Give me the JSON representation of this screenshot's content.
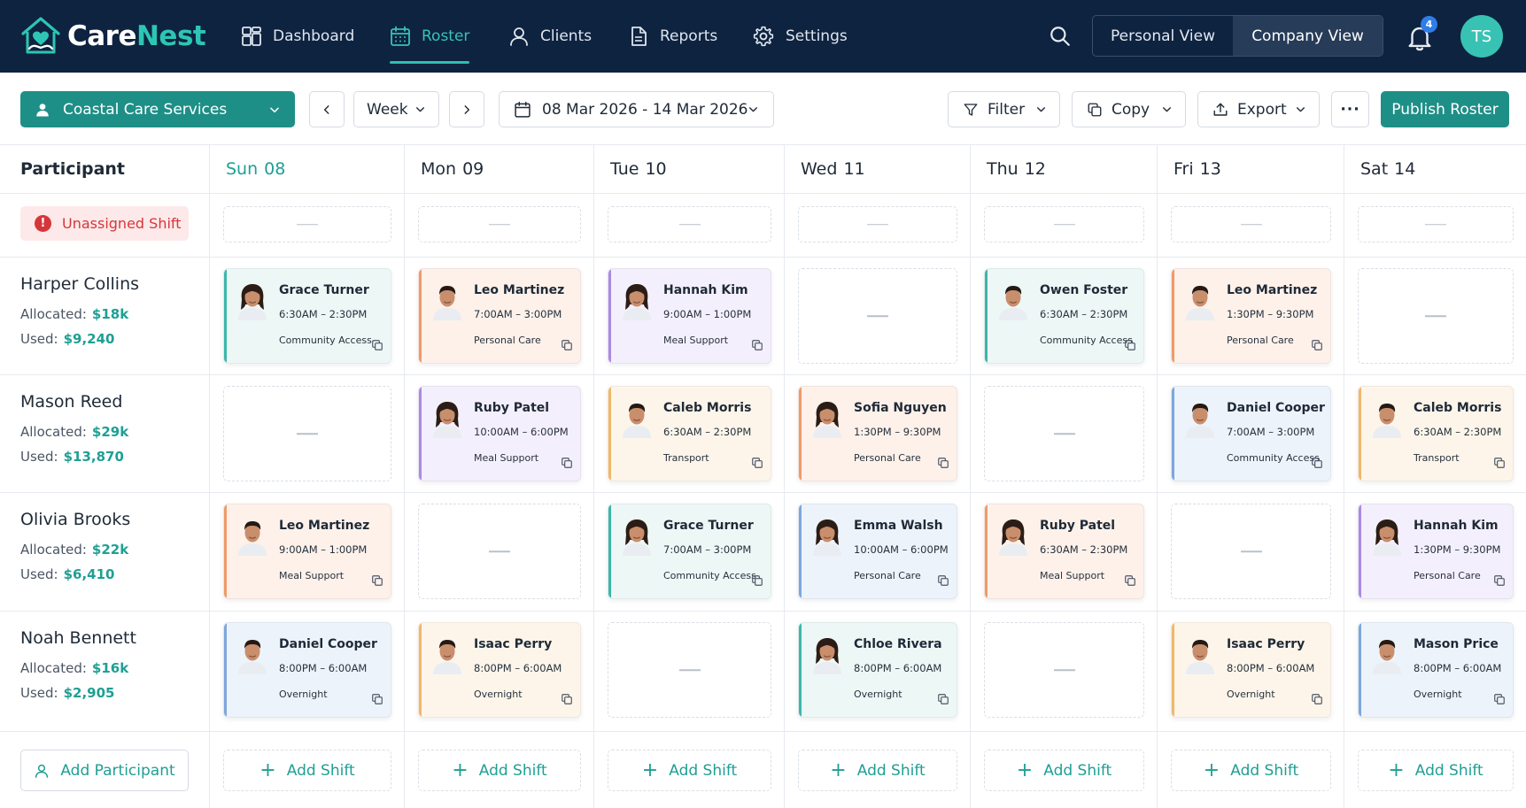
{
  "brand": {
    "name_part1": "Care",
    "name_part2": "Nest",
    "accent": "#2dc5b4",
    "header_bg": "#0e2340"
  },
  "nav": [
    {
      "label": "Dashboard",
      "icon": "dashboard-icon",
      "active": false
    },
    {
      "label": "Roster",
      "icon": "calendar-icon",
      "active": true
    },
    {
      "label": "Clients",
      "icon": "user-icon",
      "active": false
    },
    {
      "label": "Reports",
      "icon": "document-icon",
      "active": false
    },
    {
      "label": "Settings",
      "icon": "gear-icon",
      "active": false
    }
  ],
  "header": {
    "view_personal": "Personal View",
    "view_company": "Company View",
    "selected_view": "Company View",
    "notification_count": "4",
    "avatar_initials": "TS"
  },
  "toolbar": {
    "organization": "Coastal Care Services",
    "range_mode": "Week",
    "date_range": "08 Mar 2026 - 14 Mar 2026",
    "filter": "Filter",
    "copy": "Copy",
    "export": "Export",
    "more": "···",
    "publish": "Publish Roster"
  },
  "grid": {
    "participant_header": "Participant",
    "unassigned_label": "Unassigned Shift",
    "days": [
      {
        "dow": "Sun",
        "date": "08",
        "today": true
      },
      {
        "dow": "Mon",
        "date": "09",
        "today": false
      },
      {
        "dow": "Tue",
        "date": "10",
        "today": false
      },
      {
        "dow": "Wed",
        "date": "11",
        "today": false
      },
      {
        "dow": "Thu",
        "date": "12",
        "today": false
      },
      {
        "dow": "Fri",
        "date": "13",
        "today": false
      },
      {
        "dow": "Sat",
        "date": "14",
        "today": false
      }
    ],
    "allocated_label": "Allocated:",
    "used_label": "Used:",
    "add_participant": "Add Participant",
    "add_shift": "Add Shift",
    "rows": [
      {
        "participant": "Harper Collins",
        "allocated": "$18k",
        "used": "$9,240",
        "shifts": [
          {
            "worker": "Grace Turner",
            "time": "6:30AM – 2:30PM",
            "type": "Community Access",
            "color": "teal",
            "face": "f"
          },
          {
            "worker": "Leo Martinez",
            "time": "7:00AM – 3:00PM",
            "type": "Personal Care",
            "color": "orange",
            "face": "m"
          },
          {
            "worker": "Hannah Kim",
            "time": "9:00AM – 1:00PM",
            "type": "Meal Support",
            "color": "purple",
            "face": "f"
          },
          null,
          {
            "worker": "Owen Foster",
            "time": "6:30AM – 2:30PM",
            "type": "Community Access",
            "color": "teal",
            "face": "m"
          },
          {
            "worker": "Leo Martinez",
            "time": "1:30PM – 9:30PM",
            "type": "Personal Care",
            "color": "orange",
            "face": "m"
          },
          null
        ]
      },
      {
        "participant": "Mason Reed",
        "allocated": "$29k",
        "used": "$13,870",
        "shifts": [
          null,
          {
            "worker": "Ruby Patel",
            "time": "10:00AM – 6:00PM",
            "type": "Meal Support",
            "color": "purple",
            "face": "f"
          },
          {
            "worker": "Caleb Morris",
            "time": "6:30AM – 2:30PM",
            "type": "Transport",
            "color": "peach",
            "face": "m"
          },
          {
            "worker": "Sofia Nguyen",
            "time": "1:30PM – 9:30PM",
            "type": "Personal Care",
            "color": "orange",
            "face": "f"
          },
          null,
          {
            "worker": "Daniel Cooper",
            "time": "7:00AM – 3:00PM",
            "type": "Community Access",
            "color": "blue",
            "face": "m"
          },
          {
            "worker": "Caleb Morris",
            "time": "6:30AM – 2:30PM",
            "type": "Transport",
            "color": "peach",
            "face": "m"
          }
        ]
      },
      {
        "participant": "Olivia Brooks",
        "allocated": "$22k",
        "used": "$6,410",
        "shifts": [
          {
            "worker": "Leo Martinez",
            "time": "9:00AM – 1:00PM",
            "type": "Meal Support",
            "color": "orange",
            "face": "m"
          },
          null,
          {
            "worker": "Grace Turner",
            "time": "7:00AM – 3:00PM",
            "type": "Community Access",
            "color": "teal",
            "face": "f"
          },
          {
            "worker": "Emma Walsh",
            "time": "10:00AM – 6:00PM",
            "type": "Personal Care",
            "color": "blue",
            "face": "f"
          },
          {
            "worker": "Ruby Patel",
            "time": "6:30AM – 2:30PM",
            "type": "Meal Support",
            "color": "orange",
            "face": "f"
          },
          null,
          {
            "worker": "Hannah Kim",
            "time": "1:30PM – 9:30PM",
            "type": "Personal Care",
            "color": "purple",
            "face": "f"
          }
        ]
      },
      {
        "participant": "Noah Bennett",
        "allocated": "$16k",
        "used": "$2,905",
        "shifts": [
          {
            "worker": "Daniel Cooper",
            "time": "8:00PM – 6:00AM",
            "type": "Overnight",
            "color": "blue",
            "face": "m"
          },
          {
            "worker": "Isaac Perry",
            "time": "8:00PM – 6:00AM",
            "type": "Overnight",
            "color": "peach",
            "face": "m"
          },
          null,
          {
            "worker": "Chloe Rivera",
            "time": "8:00PM – 6:00AM",
            "type": "Overnight",
            "color": "teal",
            "face": "f"
          },
          null,
          {
            "worker": "Isaac Perry",
            "time": "8:00PM – 6:00AM",
            "type": "Overnight",
            "color": "peach",
            "face": "m"
          },
          {
            "worker": "Mason Price",
            "time": "8:00PM – 6:00AM",
            "type": "Overnight",
            "color": "blue",
            "face": "m"
          }
        ]
      }
    ]
  }
}
